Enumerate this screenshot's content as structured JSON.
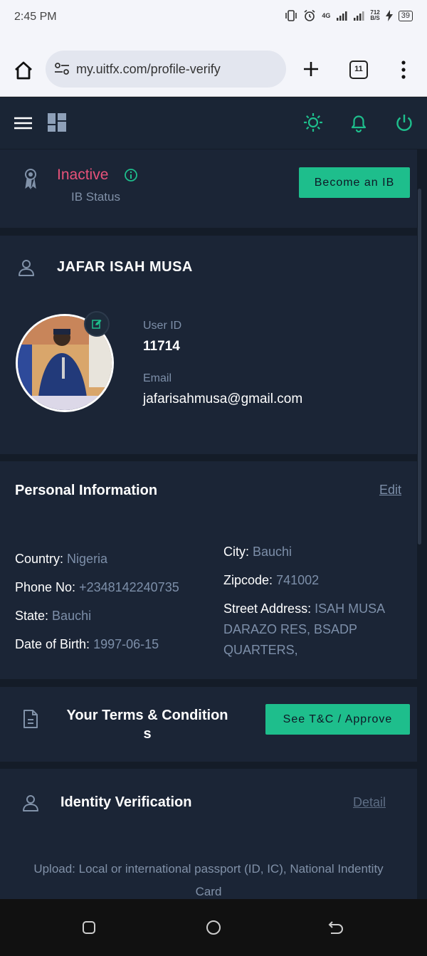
{
  "status_bar": {
    "time": "2:45 PM",
    "network": "4G",
    "speed_top": "712",
    "speed_bottom": "B/S",
    "battery": "39"
  },
  "browser": {
    "url": "my.uitfx.com/profile-verify",
    "tab_count": "11"
  },
  "ib_status": {
    "status": "Inactive",
    "label": "IB Status",
    "button": "Become an IB"
  },
  "profile": {
    "name": "JAFAR ISAH MUSA",
    "user_id_label": "User ID",
    "user_id": "11714",
    "email_label": "Email",
    "email": "jafarisahmusa@gmail.com"
  },
  "personal": {
    "title": "Personal Information",
    "edit": "Edit",
    "country_label": "Country:",
    "country": "Nigeria",
    "phone_label": "Phone No:",
    "phone": "+2348142240735",
    "state_label": "State:",
    "state": "Bauchi",
    "dob_label": "Date of Birth:",
    "dob": "1997-06-15",
    "city_label": "City:",
    "city": "Bauchi",
    "zip_label": "Zipcode:",
    "zip": "741002",
    "street_label": "Street Address:",
    "street_1": "ISAH MUSA",
    "street_2": "DARAZO RES, BSADP",
    "street_3": "QUARTERS,"
  },
  "terms": {
    "title_1": "Your Terms & Condition",
    "title_2": "s",
    "button": "See T&C / Approve"
  },
  "identity": {
    "title": "Identity Verification",
    "detail": "Detail",
    "upload_1": "Upload: Local or international passport (ID, IC), National Indentity",
    "upload_2": "Card"
  },
  "colors": {
    "accent": "#1ebe8c",
    "inactive": "#e8527a",
    "background": "#141c28",
    "card": "#1b2536"
  }
}
